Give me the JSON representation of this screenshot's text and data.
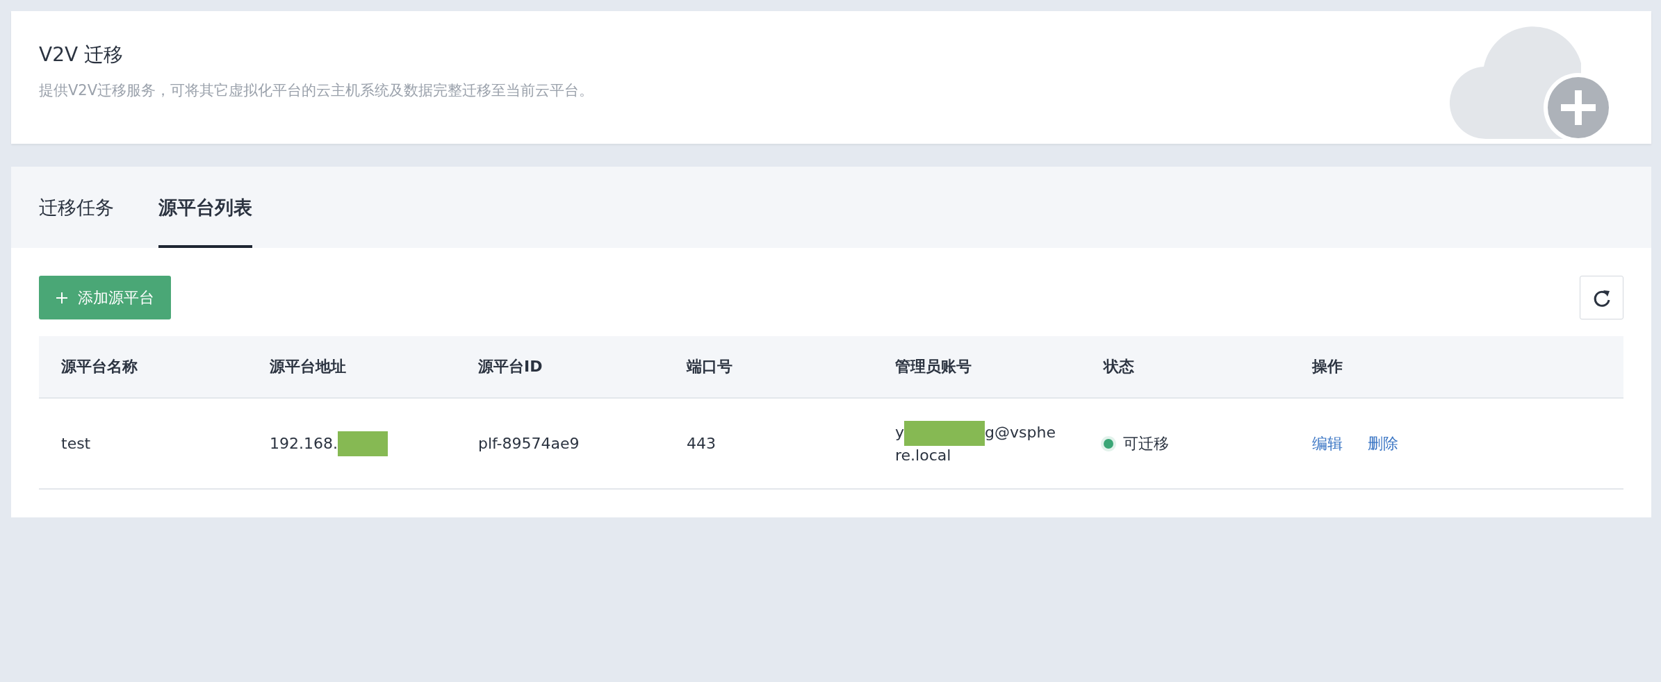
{
  "header": {
    "title": "V2V 迁移",
    "description": "提供V2V迁移服务，可将其它虚拟化平台的云主机系统及数据完整迁移至当前云平台。"
  },
  "tabs": [
    {
      "label": "迁移任务",
      "selected": false
    },
    {
      "label": "源平台列表",
      "selected": true
    }
  ],
  "toolbar": {
    "add_button": "添加源平台"
  },
  "table": {
    "columns": [
      "源平台名称",
      "源平台地址",
      "源平台ID",
      "端口号",
      "管理员账号",
      "状态",
      "操作"
    ],
    "rows": [
      {
        "name": "test",
        "address": {
          "before": "192.168.",
          "redacted": true
        },
        "id": "plf-89574ae9",
        "port": "443",
        "account": {
          "before": "y",
          "redacted": true,
          "after": "g@vsphere.local"
        },
        "status": {
          "label": "可迁移",
          "color": "#3aa676"
        },
        "actions": [
          "编辑",
          "删除"
        ]
      }
    ]
  }
}
